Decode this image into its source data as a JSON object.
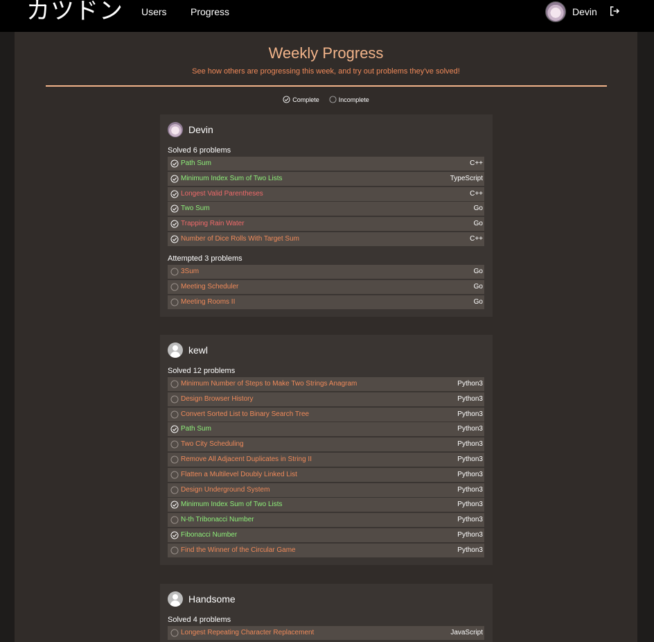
{
  "header": {
    "brand": "カツドン",
    "nav": [
      {
        "label": "Users"
      },
      {
        "label": "Progress"
      }
    ],
    "username": "Devin"
  },
  "page": {
    "title": "Weekly Progress",
    "subtitle": "See how others are progressing this week, and try out problems they've solved!",
    "legend": {
      "complete": "Complete",
      "incomplete": "Incomplete"
    }
  },
  "colors": {
    "easy": "#8ef07a",
    "medium": "#f08a5a",
    "hard": "#f06a6a",
    "accent": "#f2b48a"
  },
  "users": [
    {
      "name": "Devin",
      "avatar": "profile-image",
      "solved_title": "Solved 6 problems",
      "solved": [
        {
          "name": "Path Sum",
          "lang": "C++",
          "difficulty": "easy",
          "complete": true
        },
        {
          "name": "Minimum Index Sum of Two Lists",
          "lang": "TypeScript",
          "difficulty": "easy",
          "complete": true
        },
        {
          "name": "Longest Valid Parentheses",
          "lang": "C++",
          "difficulty": "hard",
          "complete": true
        },
        {
          "name": "Two Sum",
          "lang": "Go",
          "difficulty": "easy",
          "complete": true
        },
        {
          "name": "Trapping Rain Water",
          "lang": "Go",
          "difficulty": "hard",
          "complete": true
        },
        {
          "name": "Number of Dice Rolls With Target Sum",
          "lang": "C++",
          "difficulty": "medium",
          "complete": true
        }
      ],
      "attempted_title": "Attempted 3 problems",
      "attempted": [
        {
          "name": "3Sum",
          "lang": "Go",
          "difficulty": "medium",
          "complete": false
        },
        {
          "name": "Meeting Scheduler",
          "lang": "Go",
          "difficulty": "medium",
          "complete": false
        },
        {
          "name": "Meeting Rooms II",
          "lang": "Go",
          "difficulty": "medium",
          "complete": false
        }
      ]
    },
    {
      "name": "kewl",
      "avatar": "default-person",
      "solved_title": "Solved 12 problems",
      "solved": [
        {
          "name": "Minimum Number of Steps to Make Two Strings Anagram",
          "lang": "Python3",
          "difficulty": "medium",
          "complete": false
        },
        {
          "name": "Design Browser History",
          "lang": "Python3",
          "difficulty": "medium",
          "complete": false
        },
        {
          "name": "Convert Sorted List to Binary Search Tree",
          "lang": "Python3",
          "difficulty": "medium",
          "complete": false
        },
        {
          "name": "Path Sum",
          "lang": "Python3",
          "difficulty": "easy",
          "complete": true
        },
        {
          "name": "Two City Scheduling",
          "lang": "Python3",
          "difficulty": "medium",
          "complete": false
        },
        {
          "name": "Remove All Adjacent Duplicates in String II",
          "lang": "Python3",
          "difficulty": "medium",
          "complete": false
        },
        {
          "name": "Flatten a Multilevel Doubly Linked List",
          "lang": "Python3",
          "difficulty": "medium",
          "complete": false
        },
        {
          "name": "Design Underground System",
          "lang": "Python3",
          "difficulty": "medium",
          "complete": false
        },
        {
          "name": "Minimum Index Sum of Two Lists",
          "lang": "Python3",
          "difficulty": "easy",
          "complete": true
        },
        {
          "name": "N-th Tribonacci Number",
          "lang": "Python3",
          "difficulty": "easy",
          "complete": false
        },
        {
          "name": "Fibonacci Number",
          "lang": "Python3",
          "difficulty": "easy",
          "complete": true
        },
        {
          "name": "Find the Winner of the Circular Game",
          "lang": "Python3",
          "difficulty": "medium",
          "complete": false
        }
      ]
    },
    {
      "name": "Handsome",
      "avatar": "default-person",
      "solved_title": "Solved 4 problems",
      "solved": [
        {
          "name": "Longest Repeating Character Replacement",
          "lang": "JavaScript",
          "difficulty": "medium",
          "complete": false
        }
      ]
    }
  ]
}
